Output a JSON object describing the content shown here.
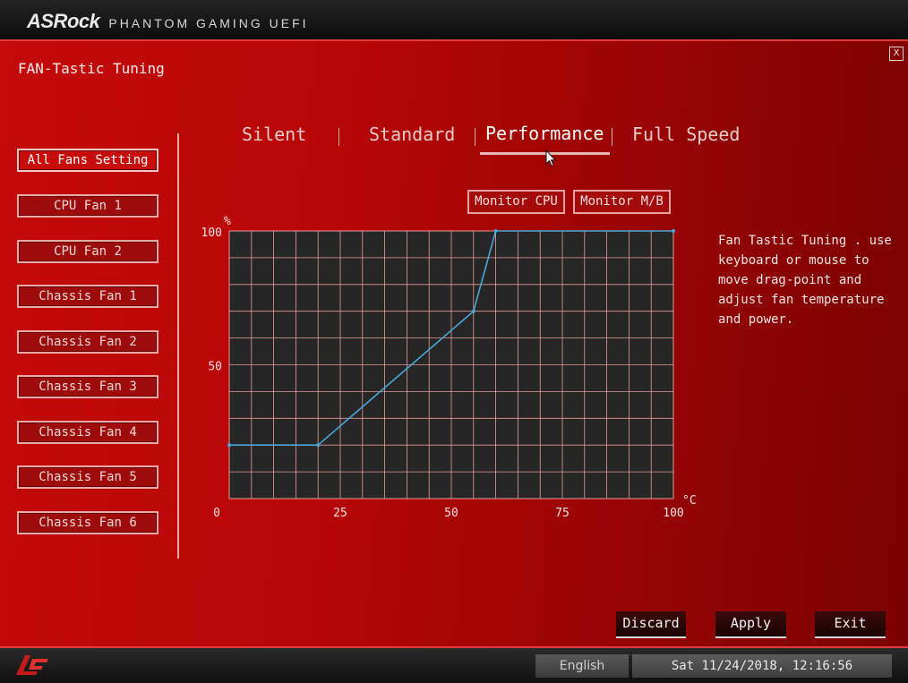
{
  "header": {
    "brand": "ASRock",
    "subtitle": "PHANTOM GAMING UEFI",
    "close_label": "X"
  },
  "page_title": "FAN-Tastic Tuning",
  "sidebar": {
    "items": [
      {
        "label": "All Fans Setting",
        "active": true
      },
      {
        "label": "CPU Fan 1",
        "active": false
      },
      {
        "label": "CPU Fan 2",
        "active": false
      },
      {
        "label": "Chassis Fan 1",
        "active": false
      },
      {
        "label": "Chassis Fan 2",
        "active": false
      },
      {
        "label": "Chassis Fan 3",
        "active": false
      },
      {
        "label": "Chassis Fan 4",
        "active": false
      },
      {
        "label": "Chassis Fan 5",
        "active": false
      },
      {
        "label": "Chassis Fan 6",
        "active": false
      }
    ]
  },
  "tabs": {
    "items": [
      {
        "label": "Silent",
        "active": false
      },
      {
        "label": "Standard",
        "active": false
      },
      {
        "label": "Performance",
        "active": true
      },
      {
        "label": "Full Speed",
        "active": false
      }
    ]
  },
  "monitor": {
    "cpu_label": "Monitor CPU",
    "mb_label": "Monitor M/B"
  },
  "chart_data": {
    "type": "line",
    "ylabel": "%",
    "xlabel": "°C",
    "xlim": [
      0,
      100
    ],
    "ylim": [
      0,
      100
    ],
    "x_ticks": [
      "0",
      "25",
      "50",
      "75",
      "100"
    ],
    "y_ticks": [
      "0",
      "50",
      "100"
    ],
    "grid": true,
    "series": [
      {
        "x": [
          0,
          20,
          55,
          60,
          100
        ],
        "y": [
          20,
          20,
          70,
          100,
          100
        ]
      }
    ],
    "colors": {
      "plot_bg": "#262626",
      "grid": "#e89a9a",
      "line": "#4da6d9"
    }
  },
  "help_text": "Fan Tastic Tuning . use\nkeyboard or mouse to\nmove drag-point and\nadjust fan temperature\nand power.",
  "actions": {
    "discard": "Discard",
    "apply": "Apply",
    "exit": "Exit"
  },
  "footer": {
    "language": "English",
    "datetime": "Sat 11/24/2018, 12:16:56"
  },
  "colors": {
    "accent": "#e23b3b",
    "background": "#b30707"
  }
}
